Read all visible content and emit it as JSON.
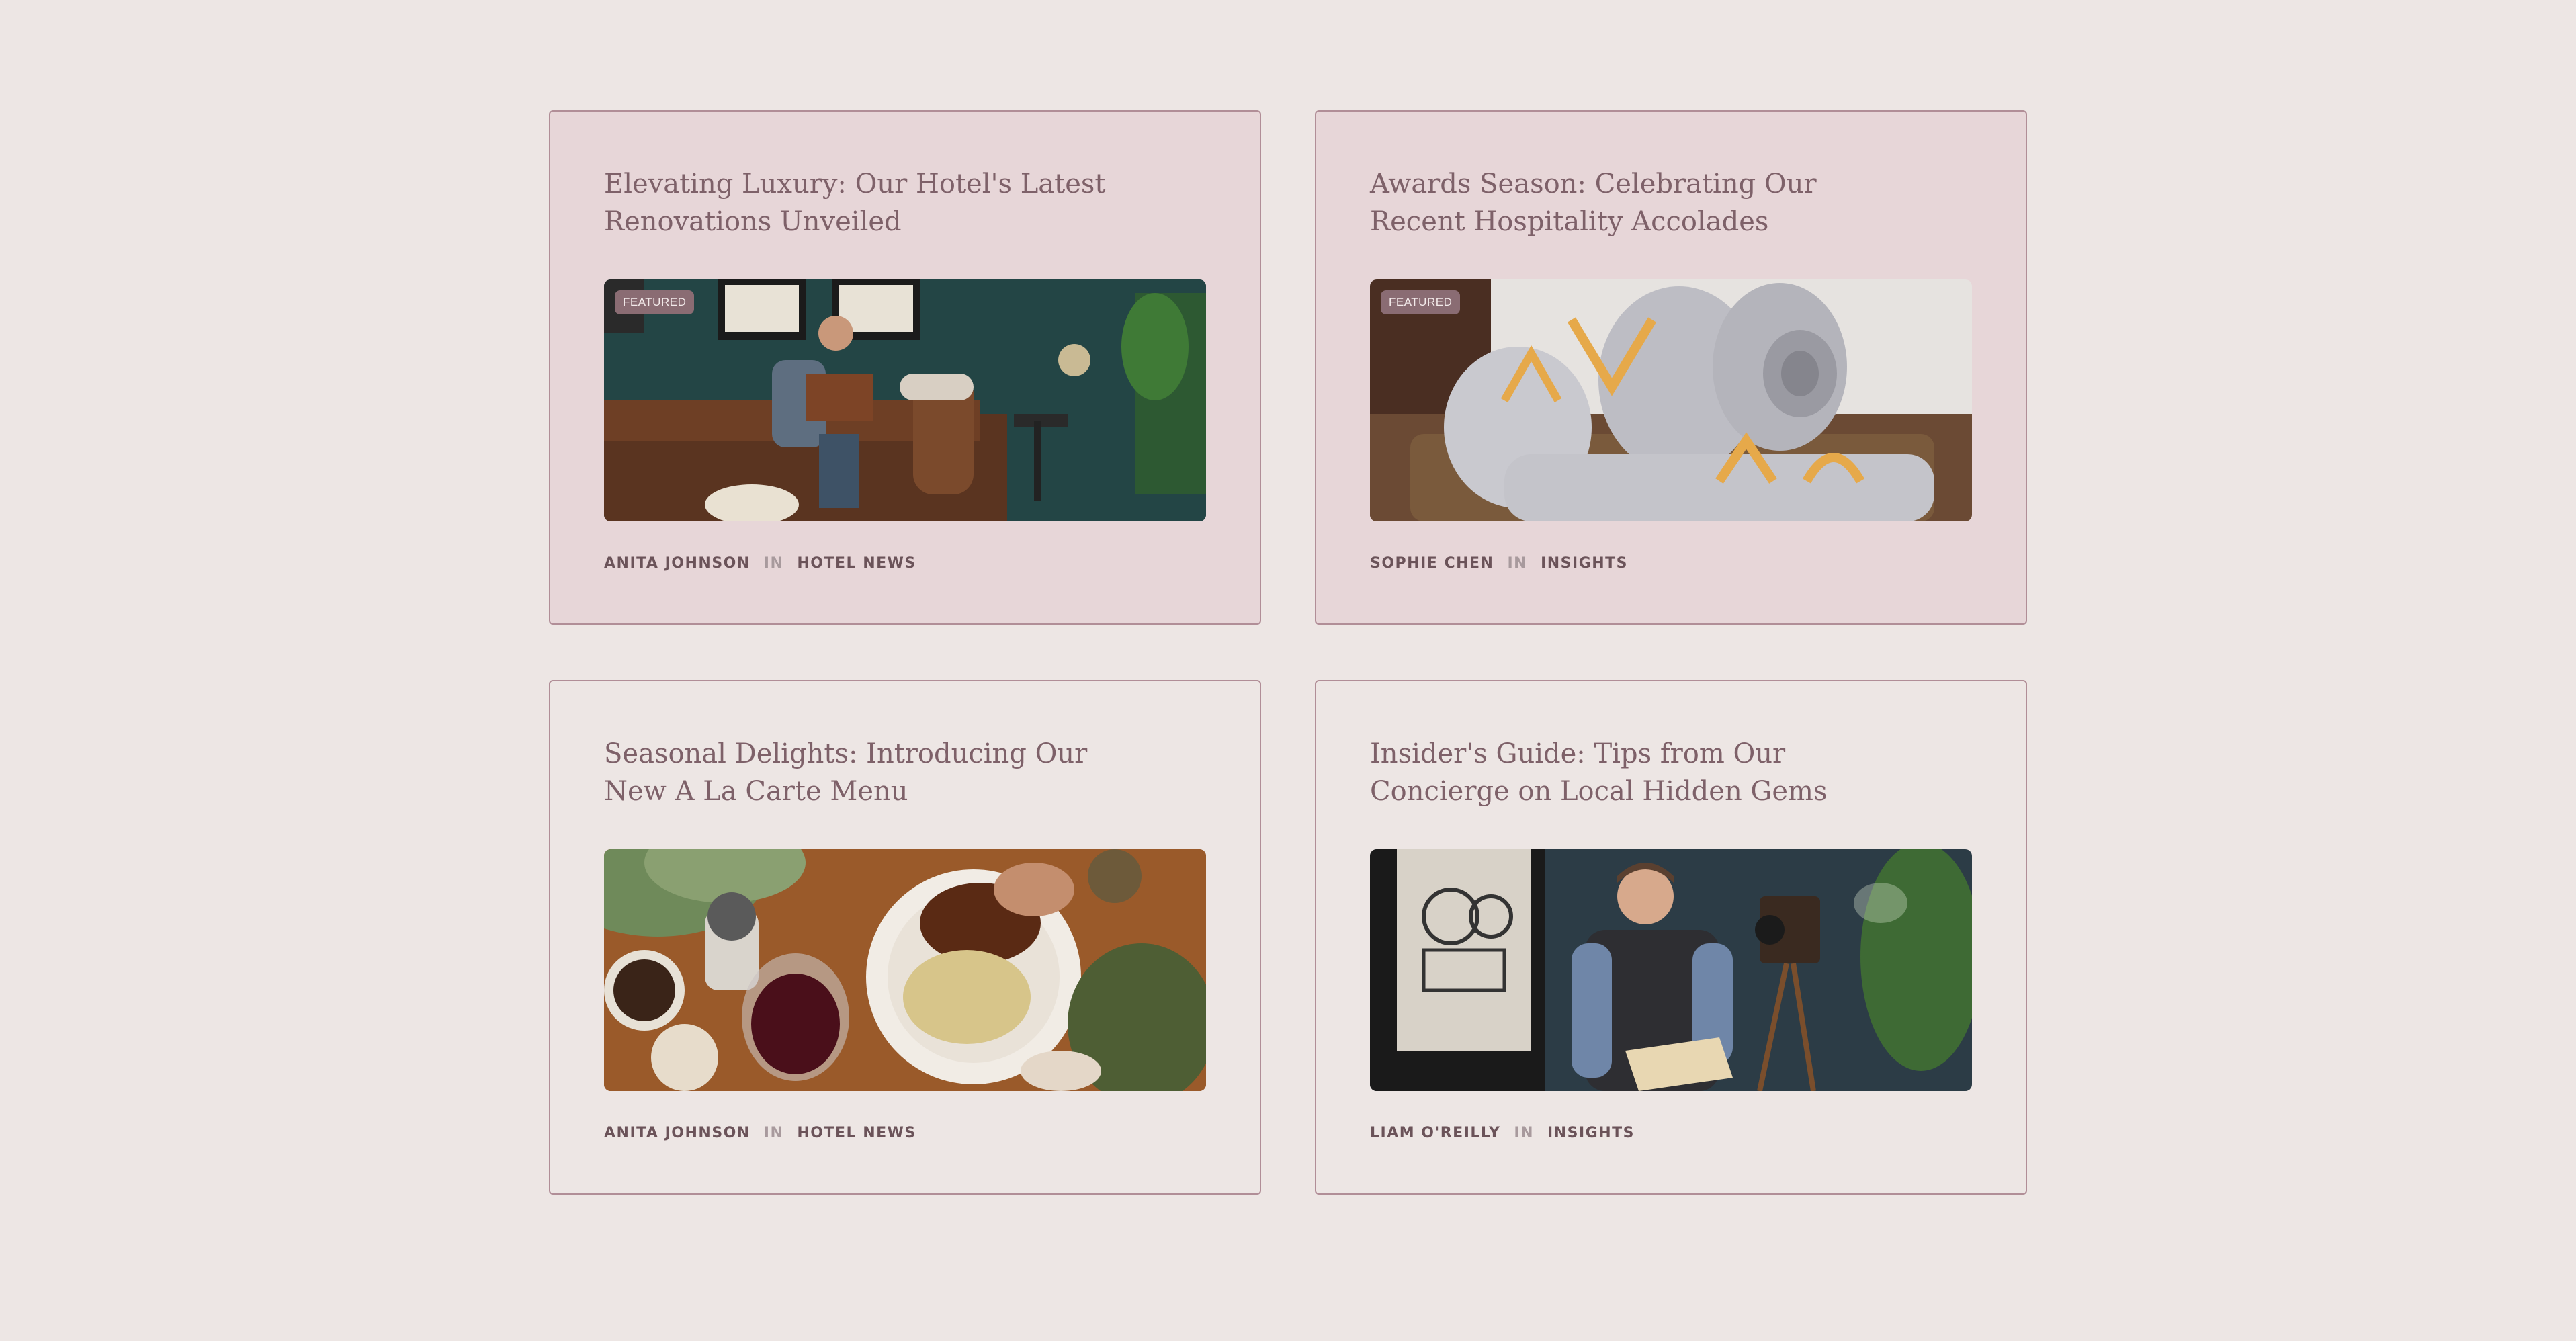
{
  "cards": [
    {
      "title": "Elevating Luxury: Our Hotel's Latest Renovations Unveiled",
      "badge": "FEATURED",
      "author": "ANITA JOHNSON",
      "in_label": "IN",
      "category": "HOTEL NEWS",
      "image": "man-reading-on-leather-sofa-photo"
    },
    {
      "title": "Awards Season: Celebrating Our Recent Hospitality Accolades",
      "badge": "FEATURED",
      "author": "SOPHIE CHEN",
      "in_label": "IN",
      "category": "INSIGHTS",
      "image": "rolled-towels-in-basket-photo"
    },
    {
      "title": "Seasonal Delights: Introducing Our New A La Carte Menu",
      "author": "ANITA JOHNSON",
      "in_label": "IN",
      "category": "HOTEL NEWS",
      "image": "steak-and-wine-dish-photo"
    },
    {
      "title": "Insider's Guide: Tips from Our Concierge on Local Hidden Gems",
      "author": "LIAM O'REILLY",
      "in_label": "IN",
      "category": "INSIGHTS",
      "image": "man-thinking-with-book-photo"
    }
  ],
  "colors": {
    "page_background": "#ede6e4",
    "featured_card_background": "#e7d6d8",
    "card_border": "#b18e97",
    "title_text": "#7e6169",
    "meta_text": "#6b5359",
    "badge_background": "#8a6c73"
  }
}
